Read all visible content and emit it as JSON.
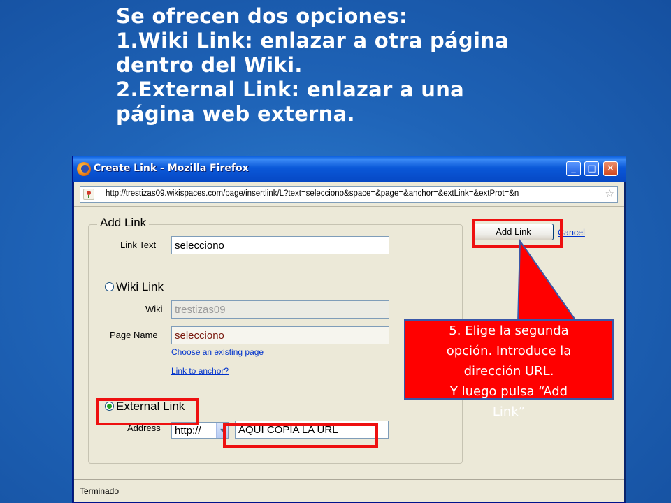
{
  "slide": {
    "lines": [
      "Se ofrecen dos opciones:",
      "1.Wiki Link: enlazar a otra página",
      "dentro del Wiki.",
      "2.External Link: enlazar a una",
      "página web externa."
    ]
  },
  "window": {
    "title": "Create Link - Mozilla Firefox",
    "url": "http://trestizas09.wikispaces.com/page/insertlink/L?text=selecciono&space=&page=&anchor=&extLink=&extProt=&n",
    "status": "Terminado"
  },
  "form": {
    "legend": "Add Link",
    "link_text_label": "Link Text",
    "link_text_value": "selecciono",
    "wiki_link_label": "Wiki Link",
    "wiki_label": "Wiki",
    "wiki_value": "trestizas09",
    "page_name_label": "Page Name",
    "page_name_value": "selecciono",
    "choose_page_link": "Choose an existing page",
    "anchor_link": "Link to anchor?",
    "external_link_label": "External Link",
    "address_label": "Address",
    "protocol_value": "http://",
    "address_value": "AQUÍ COPIA LA URL",
    "add_link_button": "Add Link",
    "cancel_link": "Cancel"
  },
  "callout": {
    "lines": [
      "5. Elige la segunda",
      "opción. Introduce la",
      "dirección URL.",
      "Y luego pulsa “Add",
      "Link”"
    ]
  },
  "colors": {
    "background": "#1f64b8",
    "annotation": "#ee1010",
    "callout": "#ff0000"
  },
  "icons": {
    "browser": "firefox-icon",
    "site": "wikispaces-icon",
    "bookmark": "star-icon",
    "warning": "warning-icon"
  }
}
